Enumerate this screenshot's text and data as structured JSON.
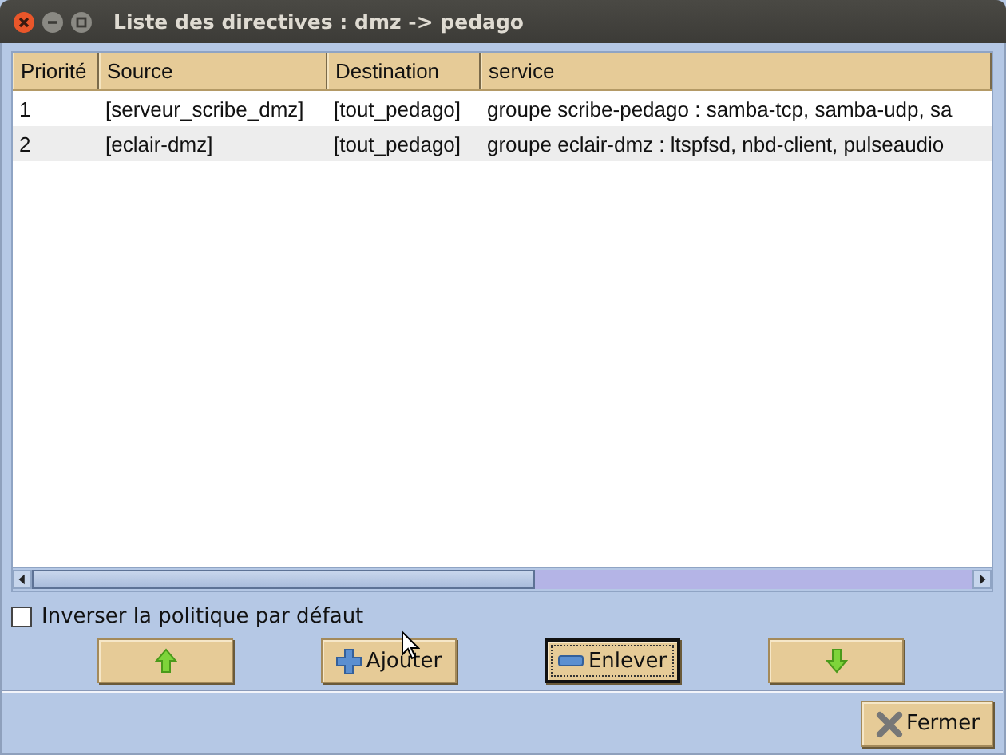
{
  "window": {
    "title": "Liste des directives : dmz -> pedago"
  },
  "table": {
    "columns": [
      "Priorité",
      "Source",
      "Destination",
      "service"
    ],
    "rows": [
      {
        "cells": [
          "1",
          "[serveur_scribe_dmz]",
          "[tout_pedago]",
          "groupe scribe-pedago : samba-tcp, samba-udp, sa"
        ]
      },
      {
        "cells": [
          "2",
          "[eclair-dmz]",
          "[tout_pedago]",
          "groupe eclair-dmz : ltspfsd, nbd-client, pulseaudio"
        ]
      }
    ]
  },
  "checkbox": {
    "label": "Inverser la politique par défaut",
    "checked": false
  },
  "buttons": [
    {
      "kind": "up",
      "focused": false
    },
    {
      "kind": "add",
      "label": "Ajouter",
      "focused": false
    },
    {
      "kind": "remove",
      "label": "Enlever",
      "focused": true
    },
    {
      "kind": "down",
      "focused": false
    }
  ],
  "close_button": {
    "label": "Fermer"
  }
}
